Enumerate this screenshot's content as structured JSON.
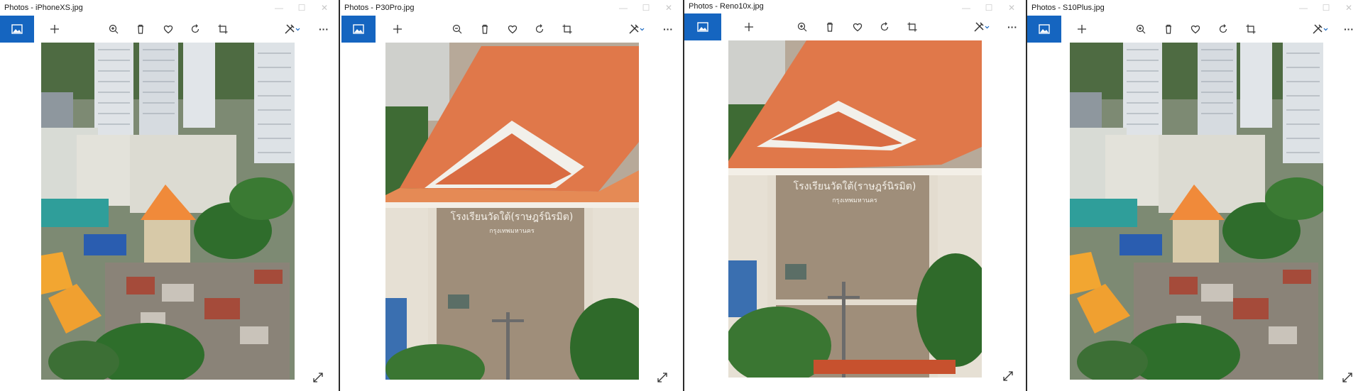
{
  "windows": [
    {
      "title": "Photos - iPhoneXS.jpg",
      "photo_type": "cityscape",
      "palette": {
        "accent": "#f08a3a"
      }
    },
    {
      "title": "Photos - P30Pro.jpg",
      "photo_type": "building-closeup",
      "palette": {
        "accent": "#e07a4c"
      }
    },
    {
      "title": "Photos - Reno10x.jpg",
      "photo_type": "building-closeup",
      "palette": {
        "accent": "#e07a4c"
      }
    },
    {
      "title": "Photos - S10Plus.jpg",
      "photo_type": "cityscape",
      "palette": {
        "accent": "#f08a3a"
      }
    }
  ],
  "toolbar": {
    "icons": [
      "album-icon",
      "add-icon",
      "zoom-icon",
      "delete-icon",
      "favorite-icon",
      "rotate-icon",
      "crop-icon",
      "edit-icon",
      "more-icon"
    ],
    "more_label": "···"
  },
  "building_sign": {
    "line1": "โรงเรียนวัดใต้(ราษฎร์นิรมิต)",
    "line2": "กรุงเทพมหานคร"
  },
  "colors": {
    "album_blue": "#1565c0",
    "toolbar_icon": "#333333"
  }
}
